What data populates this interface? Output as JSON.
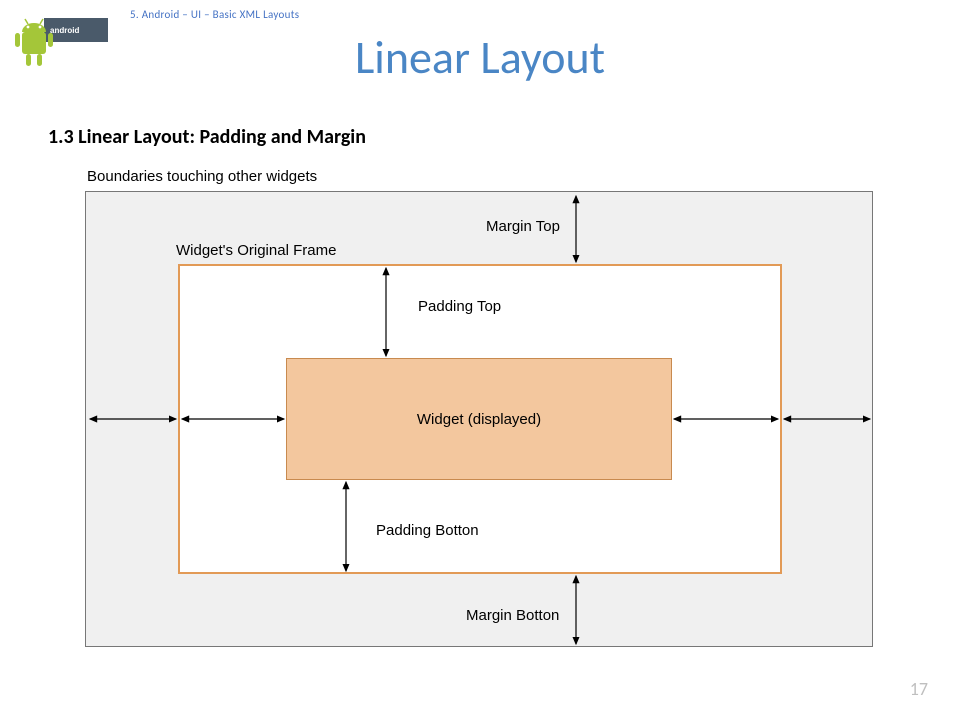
{
  "breadcrumb": "5. Android – UI – Basic XML Layouts",
  "title": "Linear Layout",
  "subtitle": "1.3   Linear Layout:  Padding  and Margin",
  "diagram": {
    "boundaries_label": "Boundaries touching other widgets",
    "frame_label": "Widget's Original Frame",
    "widget_label": "Widget (displayed)",
    "margin_top": "Margin Top",
    "margin_bottom": "Margin Botton",
    "padding_top": "Padding Top",
    "padding_bottom": "Padding Botton"
  },
  "page_number": "17"
}
